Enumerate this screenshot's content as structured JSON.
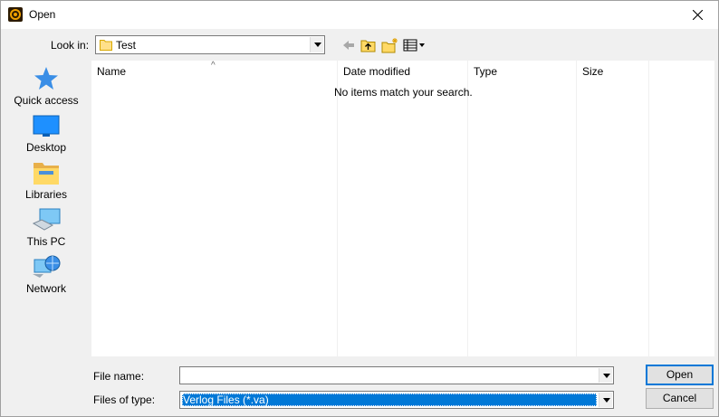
{
  "window": {
    "title": "Open"
  },
  "toolbar": {
    "look_in_label": "Look in:",
    "look_in_value": "Test",
    "icons": [
      "back-arrow-icon",
      "up-folder-icon",
      "new-folder-icon",
      "view-menu-icon"
    ]
  },
  "places": [
    {
      "label": "Quick access",
      "icon": "star-icon"
    },
    {
      "label": "Desktop",
      "icon": "desktop-icon"
    },
    {
      "label": "Libraries",
      "icon": "libraries-icon"
    },
    {
      "label": "This PC",
      "icon": "computer-icon"
    },
    {
      "label": "Network",
      "icon": "network-icon"
    }
  ],
  "filelist": {
    "columns": [
      "Name",
      "Date modified",
      "Type",
      "Size"
    ],
    "empty_message": "No items match your search."
  },
  "footer": {
    "file_name_label": "File name:",
    "file_name_value": "",
    "file_type_label": "Files of type:",
    "file_type_value": "Verlog Files (*.va)",
    "open_button": "Open",
    "cancel_button": "Cancel"
  },
  "colors": {
    "selection": "#0078d7",
    "folder": "#ffd966",
    "accent": "#1e90ff"
  }
}
